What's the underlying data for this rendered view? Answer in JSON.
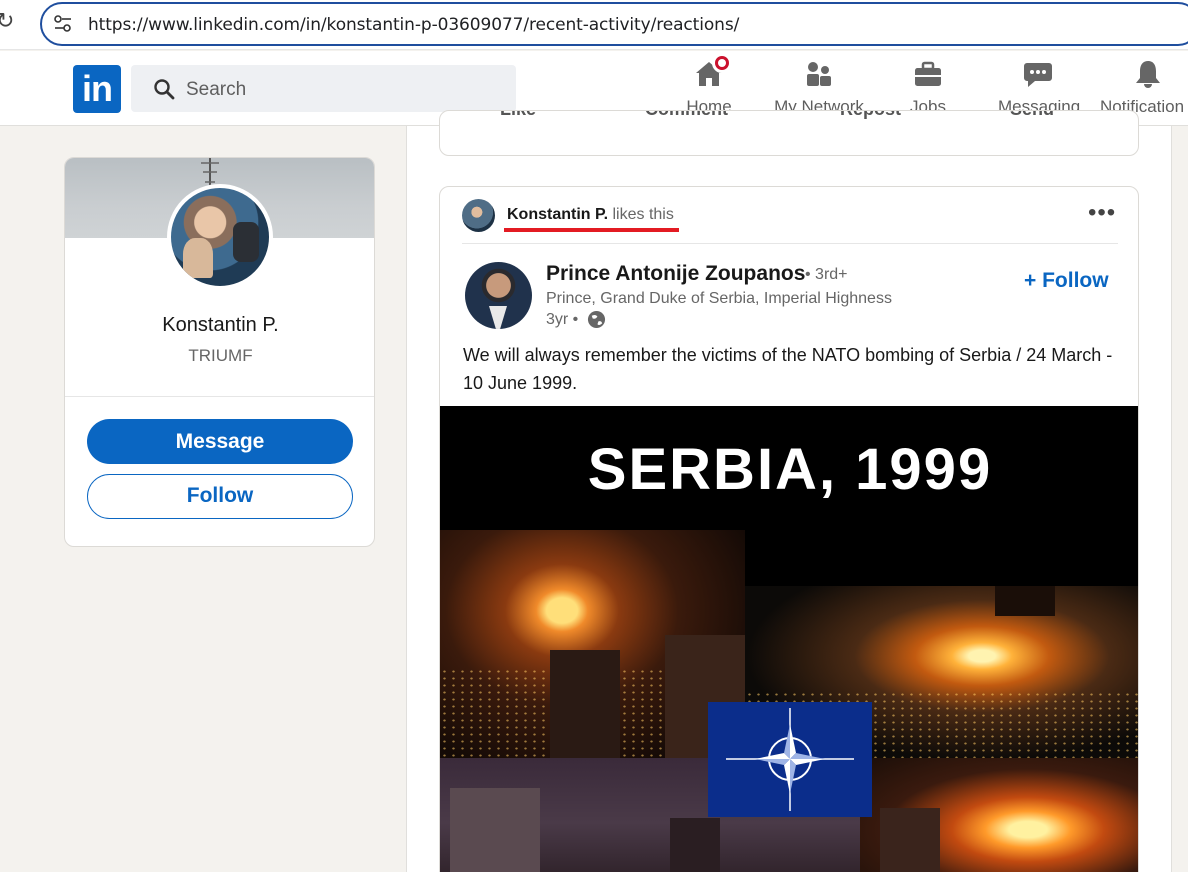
{
  "browser": {
    "url": "https://www.linkedin.com/in/konstantin-p-03609077/recent-activity/reactions/"
  },
  "header": {
    "logo": "in",
    "search_placeholder": "Search",
    "nav": [
      {
        "label": "Home",
        "icon": "home-icon"
      },
      {
        "label": "My Network",
        "icon": "network-icon"
      },
      {
        "label": "Jobs",
        "icon": "briefcase-icon"
      },
      {
        "label": "Messaging",
        "icon": "messaging-icon"
      },
      {
        "label": "Notification",
        "icon": "bell-icon"
      }
    ]
  },
  "profile": {
    "name": "Konstantin P.",
    "company": "TRIUMF",
    "message_button": "Message",
    "follow_button": "Follow"
  },
  "previous_post_actions": [
    "Like",
    "Comment",
    "Repost",
    "Send"
  ],
  "post": {
    "liker_name": "Konstantin P.",
    "liker_action": "likes this",
    "author_name": "Prince Antonije Zoupanos",
    "author_degree": "• 3rd+",
    "author_title": "Prince, Grand Duke of Serbia, Imperial Highness",
    "time": "3yr •",
    "follow_label": "+ Follow",
    "text": "We will always remember the victims of the NATO bombing of Serbia / 24 March - 10 June 1999.",
    "image_title": "SERBIA, 1999"
  },
  "colors": {
    "brand": "#0a66c2",
    "highlight_underline": "#e31b23",
    "notification_badge": "#cb112d"
  }
}
